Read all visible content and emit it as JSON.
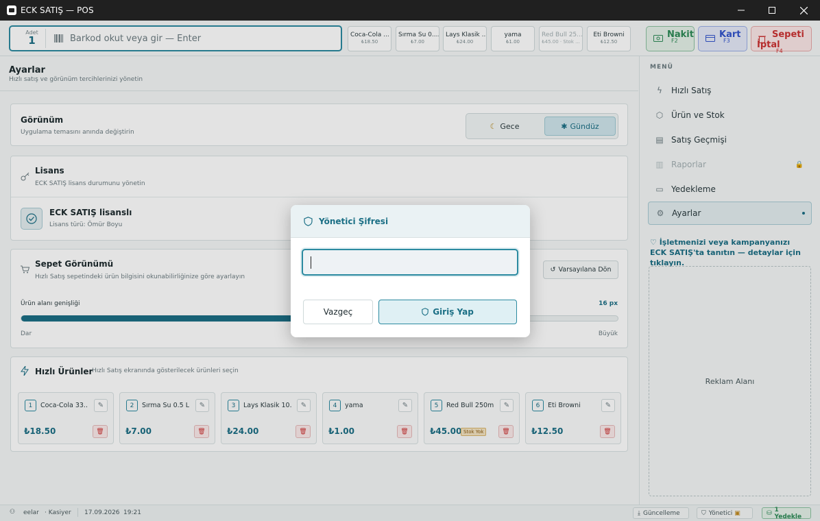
{
  "window": {
    "title": "ECK SATIŞ — POS"
  },
  "scanner": {
    "qty_label": "Adet",
    "qty_value": "1",
    "placeholder": "Barkod okut veya gir — Enter"
  },
  "quick_bar": [
    {
      "name": "Coca-Cola ...",
      "price": "₺18.50",
      "disabled": false
    },
    {
      "name": "Sırma Su 0....",
      "price": "₺7.00",
      "disabled": false
    },
    {
      "name": "Lays Klasik ...",
      "price": "₺24.00",
      "disabled": false
    },
    {
      "name": "yama",
      "price": "₺1.00",
      "disabled": false
    },
    {
      "name": "Red Bull 25...",
      "price": "₺45.00 · Stok ...",
      "disabled": true
    },
    {
      "name": "Eti Browni",
      "price": "₺12.50",
      "disabled": false
    }
  ],
  "payment": {
    "cash": {
      "label": "Nakit",
      "key": "F2"
    },
    "card": {
      "label": "Kart",
      "key": "F3"
    },
    "cancel": {
      "label": "Sepeti İptal",
      "key": "F4"
    }
  },
  "page": {
    "title": "Ayarlar",
    "subtitle": "Hızlı satış ve görünüm tercihlerinizi yönetin"
  },
  "appearance": {
    "title": "Görünüm",
    "subtitle": "Uygulama temasını anında değiştirin",
    "night_label": "Gece",
    "day_label": "Gündüz",
    "selected": "Gündüz"
  },
  "license": {
    "title": "Lisans",
    "subtitle": "ECK SATIŞ lisans durumunu yönetin",
    "status_title": "ECK SATIŞ lisanslı",
    "status_sub": "Lisans türü: Ömür Boyu"
  },
  "cart_view": {
    "title": "Sepet Görünümü",
    "subtitle": "Hızlı Satış sepetindeki ürün bilgisini okunabilirliğinize göre ayarlayın",
    "reset_label": "Varsayılana Dön",
    "slider_label": "Ürün alanı genişliği",
    "slider_value": "16 px",
    "slider_fraction": 0.5,
    "min_label": "Dar",
    "max_label": "Büyük"
  },
  "quick_products": {
    "title": "Hızlı Ürünler",
    "subtitle": "Hızlı Satış ekranında gösterilecek ürünleri seçin",
    "items": [
      {
        "num": "1",
        "name": "Coca-Cola 33...",
        "price": "₺18.50",
        "badge": ""
      },
      {
        "num": "2",
        "name": "Sırma Su 0.5 L",
        "price": "₺7.00",
        "badge": ""
      },
      {
        "num": "3",
        "name": "Lays Klasik 10...",
        "price": "₺24.00",
        "badge": ""
      },
      {
        "num": "4",
        "name": "yama",
        "price": "₺1.00",
        "badge": ""
      },
      {
        "num": "5",
        "name": "Red Bull 250ml",
        "price": "₺45.00",
        "badge": "Stok Yok"
      },
      {
        "num": "6",
        "name": "Eti Browni",
        "price": "₺12.50",
        "badge": ""
      }
    ]
  },
  "sidebar": {
    "menu_header": "MENÜ",
    "items": [
      {
        "label": "Hızlı Satış",
        "icon": "bolt-icon",
        "state": "normal"
      },
      {
        "label": "Ürün ve Stok",
        "icon": "box-icon",
        "state": "normal"
      },
      {
        "label": "Satış Geçmişi",
        "icon": "receipt-icon",
        "state": "normal"
      },
      {
        "label": "Raporlar",
        "icon": "chart-icon",
        "state": "disabled"
      },
      {
        "label": "Yedekleme",
        "icon": "archive-icon",
        "state": "normal"
      },
      {
        "label": "Ayarlar",
        "icon": "gear-icon",
        "state": "active"
      }
    ],
    "promo": "♡ İşletmenizi veya kampanyanızı ECK SATIŞ'ta tanıtın — detaylar için tıklayın.",
    "ad_label": "Reklam Alanı"
  },
  "status": {
    "user": "eelar",
    "role": "· Kasiyer",
    "date": "17.09.2026",
    "time": "19:21",
    "update_label": "Güncelleme",
    "admin_label": "Yönetici",
    "backup_label": "1 Yedekle"
  },
  "modal": {
    "title": "Yönetici Şifresi",
    "password_value": "",
    "cancel_label": "Vazgeç",
    "login_label": "Giriş Yap"
  },
  "colors": {
    "accent": "#1b6f85",
    "accent_border": "#2b8aa0",
    "cash": "#2e8b57",
    "card": "#3355cc",
    "danger": "#cc3333"
  }
}
